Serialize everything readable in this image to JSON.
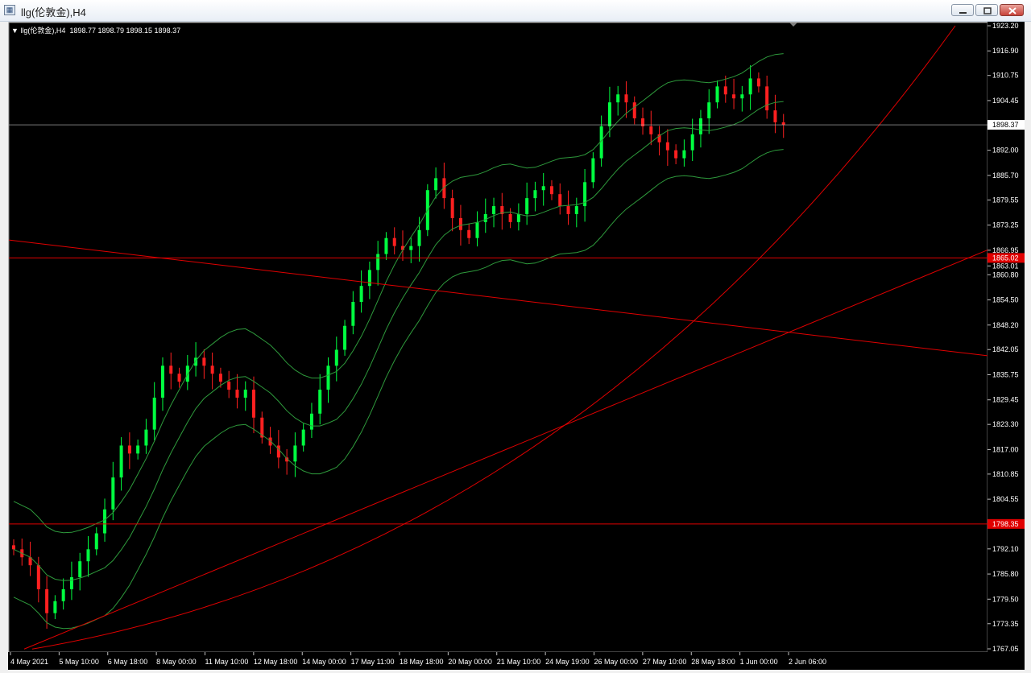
{
  "window": {
    "icon": "chart-window-icon",
    "title": "llg(伦敦金),H4",
    "buttons": [
      {
        "name": "minimize-button",
        "icon": "minimize-icon"
      },
      {
        "name": "restore-button",
        "icon": "restore-icon"
      },
      {
        "name": "close-button",
        "icon": "close-icon"
      }
    ]
  },
  "chart_info": {
    "symbol": "llg(伦敦金),H4",
    "ohlc": "1898.77 1898.79 1898.15 1898.37"
  },
  "colors": {
    "background": "#000000",
    "bull": "#00ff40",
    "bear": "#ff2020",
    "bands": "#2e9a3c",
    "trendline": "#e00000",
    "bid_line": "#c0c0c0",
    "axis_text": "#ffffff"
  },
  "chart_data": {
    "type": "candlestick",
    "ylim": [
      1767.05,
      1923.2
    ],
    "y_ticks": [
      "1923.20",
      "1916.90",
      "1910.75",
      "1904.45",
      "1898.37",
      "1892.00",
      "1885.70",
      "1879.55",
      "1873.25",
      "1866.95",
      "1863.01",
      "1860.80",
      "1854.50",
      "1848.20",
      "1842.05",
      "1835.75",
      "1829.45",
      "1823.30",
      "1817.00",
      "1810.85",
      "1804.55",
      "1798.35",
      "1792.10",
      "1785.80",
      "1779.50",
      "1773.35",
      "1767.05"
    ],
    "x_ticks": [
      "4 May 2021",
      "5 May 10:00",
      "6 May 18:00",
      "8 May 00:00",
      "11 May 10:00",
      "12 May 18:00",
      "14 May 00:00",
      "17 May 11:00",
      "18 May 18:00",
      "20 May 00:00",
      "21 May 10:00",
      "24 May 19:00",
      "26 May 00:00",
      "27 May 10:00",
      "28 May 18:00",
      "1 Jun 00:00",
      "2 Jun 06:00"
    ],
    "current_price": "1898.37",
    "horizontal_levels": [
      "1865.02",
      "1798.35"
    ],
    "close_path": [
      1792,
      1790,
      1788,
      1782,
      1776,
      1779,
      1782,
      1785,
      1789,
      1792,
      1796,
      1802,
      1810,
      1818,
      1816,
      1818,
      1822,
      1830,
      1838,
      1836,
      1834,
      1838,
      1840,
      1838,
      1836,
      1834,
      1832,
      1830,
      1832,
      1825,
      1820,
      1818,
      1815,
      1814,
      1818,
      1822,
      1826,
      1832,
      1838,
      1842,
      1848,
      1854,
      1858,
      1862,
      1866,
      1870,
      1868,
      1867,
      1868,
      1872,
      1882,
      1885,
      1880,
      1875,
      1872,
      1870,
      1874,
      1876,
      1878,
      1876,
      1874,
      1876,
      1880,
      1882,
      1883,
      1881,
      1878,
      1876,
      1878,
      1884,
      1890,
      1898,
      1904,
      1906,
      1904,
      1900,
      1898,
      1896,
      1894,
      1892,
      1890,
      1892,
      1896,
      1900,
      1904,
      1908,
      1906,
      1905,
      1906,
      1910,
      1908,
      1902,
      1899,
      1898.4
    ]
  }
}
